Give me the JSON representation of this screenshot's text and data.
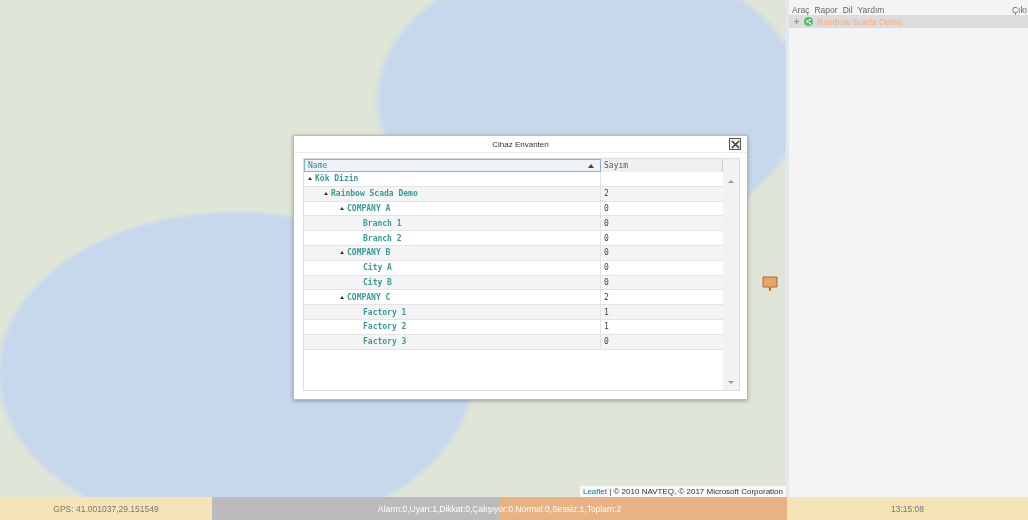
{
  "map": {
    "attribution_link": "Leaflet",
    "attribution": "| © 2010 NAVTEQ, © 2017 Microsoft Corporation"
  },
  "dialog": {
    "title": "Cihaz Envanteri",
    "columns": [
      {
        "label": "Name",
        "sorted": true
      },
      {
        "label": "Sayım",
        "sorted": false
      }
    ],
    "tree": [
      {
        "name": "Kök Dizin",
        "expanded": true,
        "children": [
          {
            "name": "Rainbow Scada Demo",
            "count": "2",
            "expanded": true,
            "children": [
              {
                "name": "COMPANY A",
                "count": "0",
                "expanded": true,
                "children": [
                  {
                    "name": "Branch 1",
                    "count": "0"
                  },
                  {
                    "name": "Branch 2",
                    "count": "0"
                  }
                ]
              },
              {
                "name": "COMPANY B",
                "count": "0",
                "expanded": true,
                "children": [
                  {
                    "name": "City A",
                    "count": "0"
                  },
                  {
                    "name": "City B",
                    "count": "0"
                  }
                ]
              },
              {
                "name": "COMPANY C",
                "count": "2",
                "expanded": true,
                "children": [
                  {
                    "name": "Factory 1",
                    "count": "1"
                  },
                  {
                    "name": "Factory 2",
                    "count": "1"
                  },
                  {
                    "name": "Factory 3",
                    "count": "0"
                  }
                ]
              }
            ]
          }
        ]
      }
    ]
  },
  "side_panel": {
    "menu": [
      "Araç",
      "Rapor",
      "Dil",
      "Yardım"
    ],
    "exit": "Çıkı",
    "tree": [
      {
        "name": "Rainbow Scada Demo",
        "expanded": false,
        "selected": true
      }
    ]
  },
  "status_bar": {
    "gps": "GPS: 41.001037,29.151549",
    "summary": "Alarm:0,Uyarı:1,Dikkat:0,Çalışıyor:0,Normal:0,Sessiz:1,Toplam:2",
    "time": "13:15:08"
  }
}
